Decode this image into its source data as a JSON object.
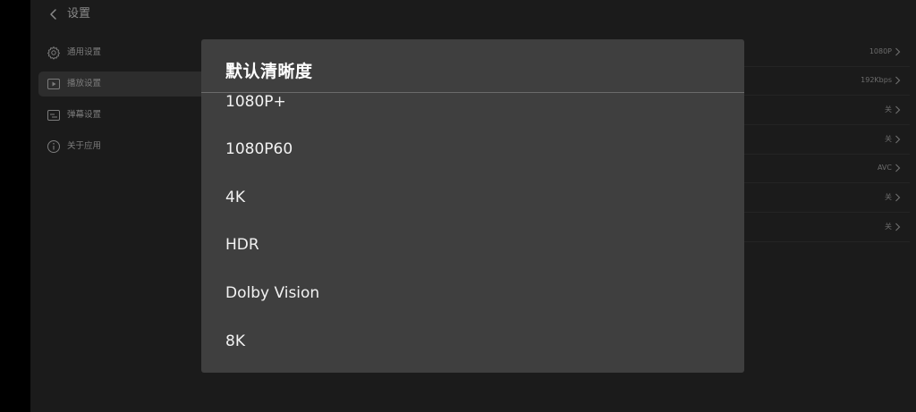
{
  "header": {
    "title": "设置"
  },
  "sidebar": {
    "items": [
      {
        "label": "通用设置",
        "icon": "gear-icon",
        "active": false
      },
      {
        "label": "播放设置",
        "icon": "play-icon",
        "active": true
      },
      {
        "label": "弹幕设置",
        "icon": "subtitle-icon",
        "active": false
      },
      {
        "label": "关于应用",
        "icon": "info-icon",
        "active": false
      }
    ]
  },
  "settings_values": [
    "1080P",
    "192Kbps",
    "关",
    "关",
    "AVC",
    "关",
    "关"
  ],
  "dialog": {
    "title": "默认清晰度",
    "options": [
      "1080P+",
      "1080P60",
      "4K",
      "HDR",
      "Dolby Vision",
      "8K"
    ]
  },
  "colors": {
    "background": "#1b1b1b",
    "dialog": "#3f3f3f",
    "active_item": "#2d2d2d"
  }
}
